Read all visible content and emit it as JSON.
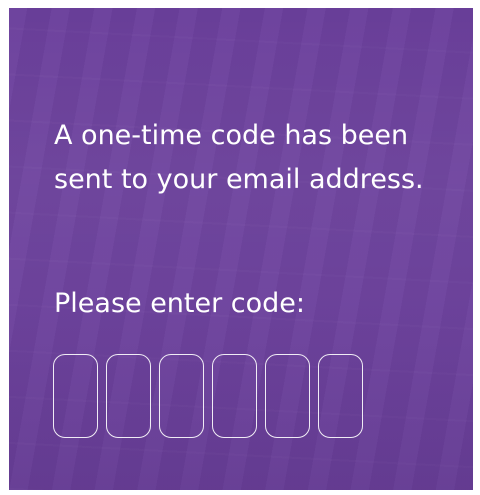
{
  "otp": {
    "message": "A one-time code has been sent to your email address.",
    "prompt": "Please enter code:",
    "digits": [
      "",
      "",
      "",
      "",
      "",
      ""
    ]
  },
  "colors": {
    "panel_background": "#6b3f9c",
    "text": "#ffffff",
    "input_border": "#ffffff"
  }
}
